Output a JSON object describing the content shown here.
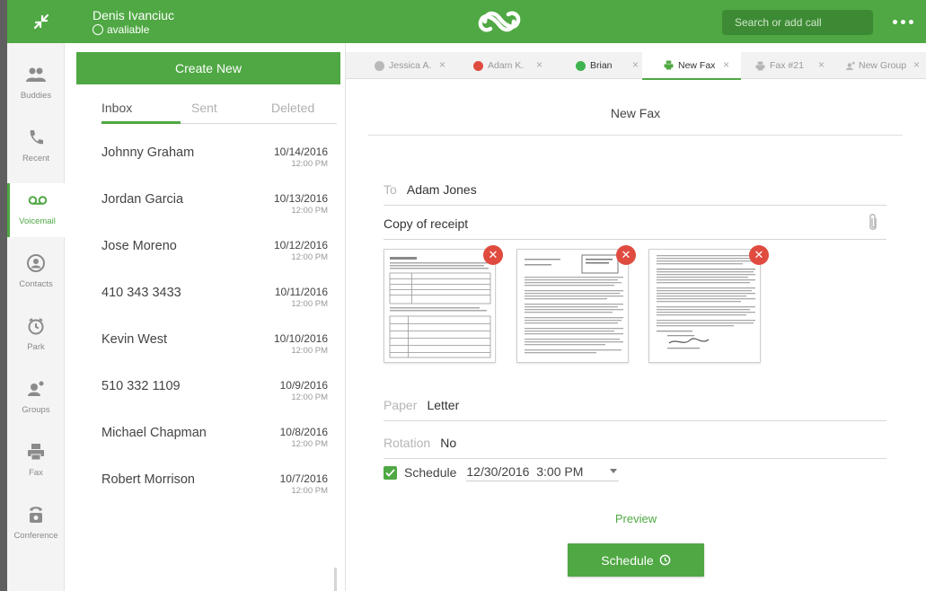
{
  "user": {
    "name": "Denis Ivanciuc",
    "status": "avaliable"
  },
  "search": {
    "placeholder": "Search or add call"
  },
  "nav": {
    "items": [
      {
        "label": "Buddies",
        "icon": "buddies-icon"
      },
      {
        "label": "Recent",
        "icon": "phone-icon"
      },
      {
        "label": "Voicemail",
        "icon": "voicemail-icon",
        "active": true
      },
      {
        "label": "Contacts",
        "icon": "contact-icon"
      },
      {
        "label": "Park",
        "icon": "park-icon"
      },
      {
        "label": "Groups",
        "icon": "groups-icon"
      },
      {
        "label": "Fax",
        "icon": "fax-icon"
      },
      {
        "label": "Conference",
        "icon": "conference-icon"
      }
    ]
  },
  "middle": {
    "create_label": "Create New",
    "tabs": [
      "Inbox",
      "Sent",
      "Deleted"
    ],
    "voicemails": [
      {
        "name": "Johnny Graham",
        "date": "10/14/2016",
        "time": "12:00 PM"
      },
      {
        "name": "Jordan Garcia",
        "date": "10/13/2016",
        "time": "12:00 PM"
      },
      {
        "name": "Jose Moreno",
        "date": "10/12/2016",
        "time": "12:00 PM"
      },
      {
        "name": "410 343 3433",
        "date": "10/11/2016",
        "time": "12:00 PM"
      },
      {
        "name": "Kevin West",
        "date": "10/10/2016",
        "time": "12:00 PM"
      },
      {
        "name": "510 332 1109",
        "date": "10/9/2016",
        "time": "12:00 PM"
      },
      {
        "name": "Michael Chapman",
        "date": "10/8/2016",
        "time": "12:00 PM"
      },
      {
        "name": "Robert Morrison",
        "date": "10/7/2016",
        "time": "12:00 PM"
      }
    ]
  },
  "tabs": [
    {
      "label": "Jessica A.",
      "status_color": "#b9b9b9"
    },
    {
      "label": "Adam K.",
      "status_color": "#e04b3f"
    },
    {
      "label": "Brian",
      "status_color": "#3fb34f"
    },
    {
      "label": "New Fax",
      "icon": "fax-icon",
      "active": true
    },
    {
      "label": "Fax #21",
      "icon": "fax-icon"
    },
    {
      "label": "New Group",
      "icon": "group-icon"
    }
  ],
  "fax": {
    "title": "New Fax",
    "to_label": "To",
    "to_value": "Adam Jones",
    "subject": "Copy of receipt",
    "paper_label": "Paper",
    "paper_value": "Letter",
    "rotation_label": "Rotation",
    "rotation_value": "No",
    "schedule_label": "Schedule",
    "schedule_checked": true,
    "schedule_datetime": "12/30/2016  3:00 PM",
    "preview_label": "Preview",
    "schedule_button": "Schedule"
  },
  "colors": {
    "brand": "#4fa843",
    "danger": "#e04b3f"
  }
}
